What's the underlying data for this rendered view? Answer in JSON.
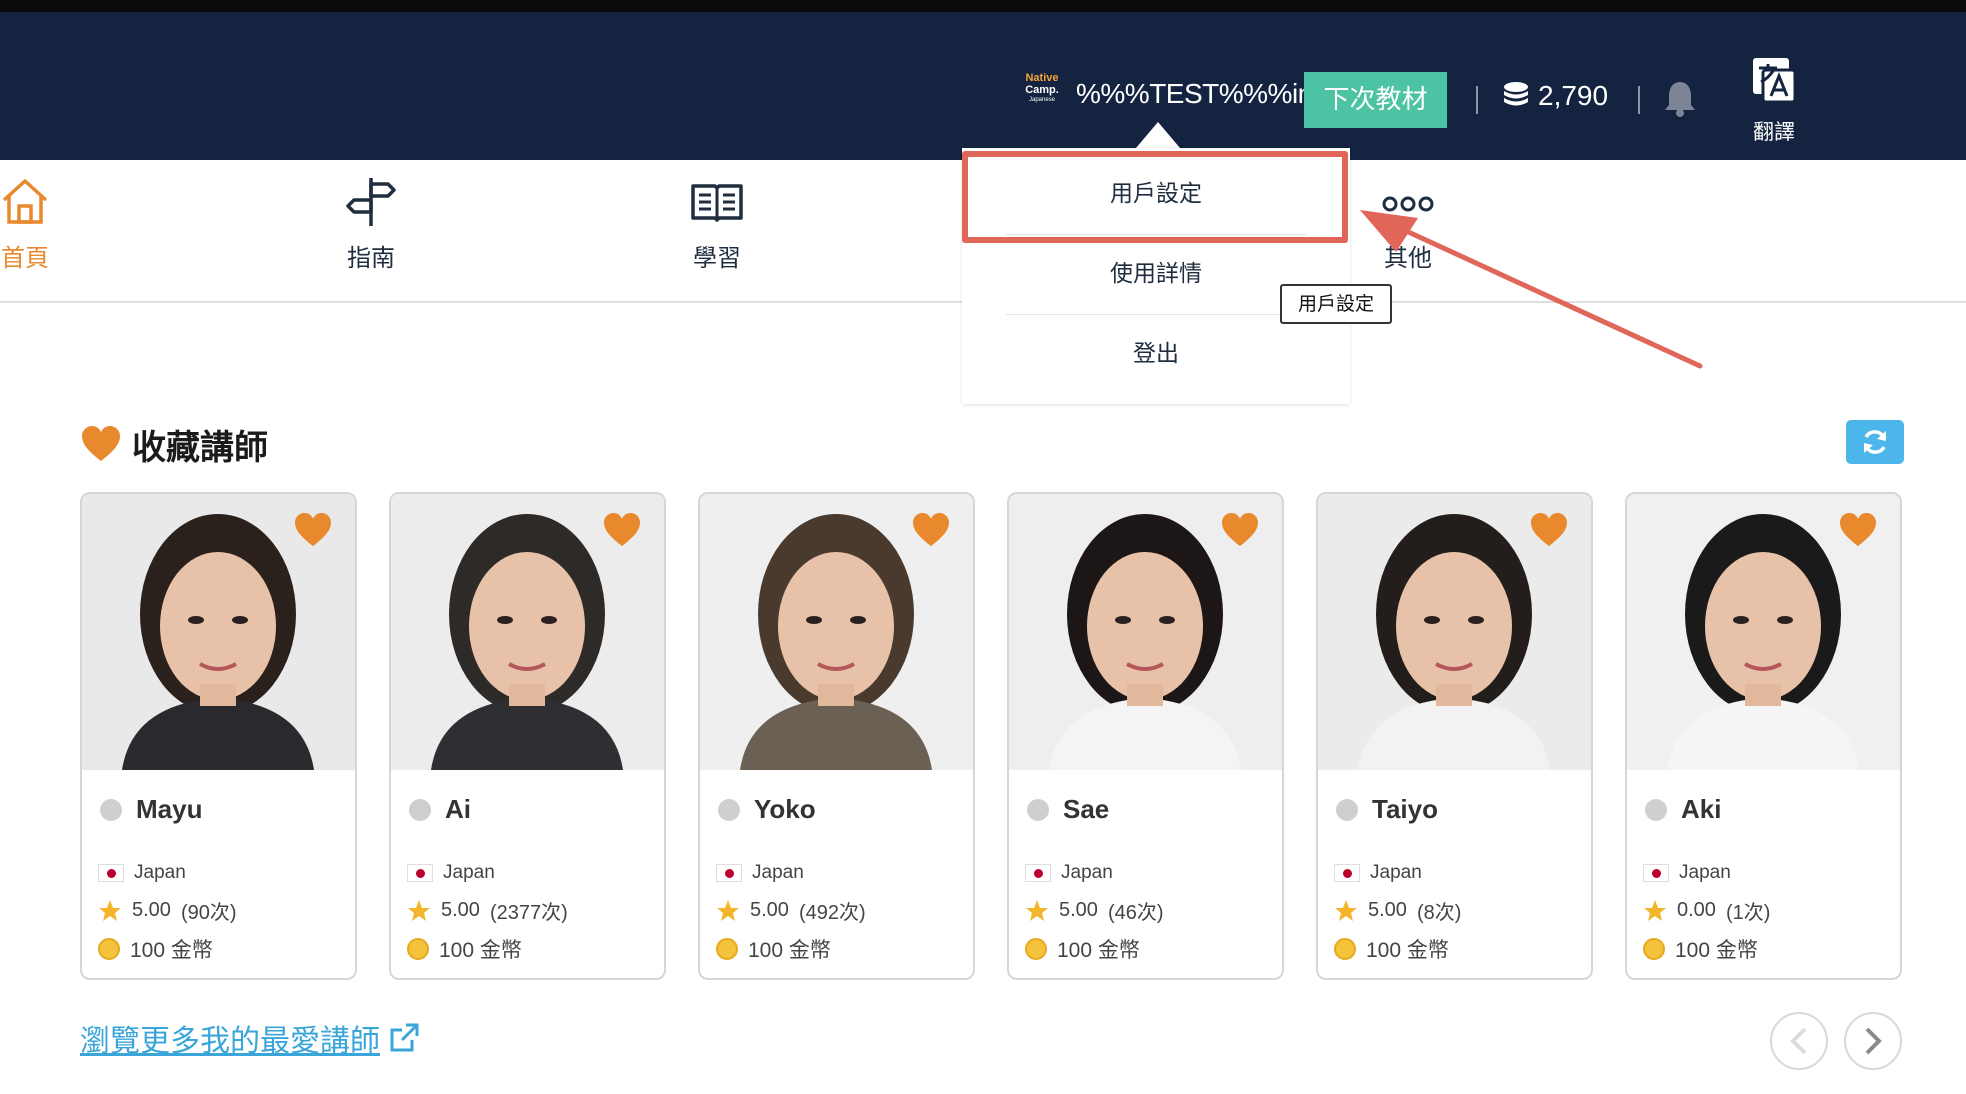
{
  "header": {
    "brand_logo": {
      "line1": "Native",
      "line2": "Camp.",
      "line3": "Japanese"
    },
    "username": "%%%TEST%%%imai",
    "next_material_label": "下次教材",
    "coin_balance": "2,790",
    "translate_label": "翻譯",
    "icons": {
      "coins": "coin-stack-icon",
      "bell": "bell-icon",
      "translate": "translate-icon"
    }
  },
  "nav": {
    "items": [
      {
        "label": "首頁",
        "icon": "home-icon",
        "active": true
      },
      {
        "label": "指南",
        "icon": "signpost-icon",
        "active": false
      },
      {
        "label": "學習",
        "icon": "book-icon",
        "active": false
      },
      {
        "label": "其他",
        "icon": "more-dots-icon",
        "active": false
      }
    ]
  },
  "dropdown": {
    "items": [
      {
        "label": "用戶設定"
      },
      {
        "label": "使用詳情"
      },
      {
        "label": "登出"
      }
    ],
    "tooltip": "用戶設定"
  },
  "favorites": {
    "title": "收藏講師",
    "teachers": [
      {
        "name": "Mayu",
        "country": "Japan",
        "rating": "5.00",
        "reviews": "(90次)",
        "price": "100 金幣"
      },
      {
        "name": "Ai",
        "country": "Japan",
        "rating": "5.00",
        "reviews": "(2377次)",
        "price": "100 金幣"
      },
      {
        "name": "Yoko",
        "country": "Japan",
        "rating": "5.00",
        "reviews": "(492次)",
        "price": "100 金幣"
      },
      {
        "name": "Sae",
        "country": "Japan",
        "rating": "5.00",
        "reviews": "(46次)",
        "price": "100 金幣"
      },
      {
        "name": "Taiyo",
        "country": "Japan",
        "rating": "5.00",
        "reviews": "(8次)",
        "price": "100 金幣"
      },
      {
        "name": "Aki",
        "country": "Japan",
        "rating": "0.00",
        "reviews": "(1次)",
        "price": "100 金幣"
      }
    ],
    "more_link": "瀏覽更多我的最愛講師"
  },
  "colors": {
    "header_bg": "#14233f",
    "accent_green": "#4cc3a3",
    "accent_orange": "#e9892e",
    "link_blue": "#3aa5d8",
    "annotation_red": "#e0665a"
  }
}
